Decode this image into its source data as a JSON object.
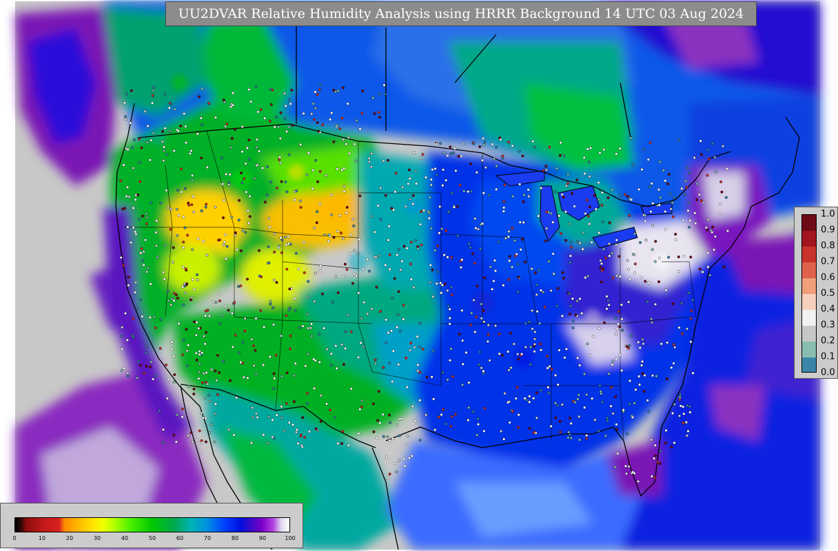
{
  "title": "UU2DVAR Relative Humidity Analysis using HRRR Background 14 UTC 03 Aug 2024",
  "rh_colorbar": {
    "ticks": [
      "0",
      "10",
      "20",
      "30",
      "40",
      "50",
      "60",
      "70",
      "80",
      "90",
      "100"
    ]
  },
  "obs_colorbar": {
    "ticks": [
      "1.0",
      "0.9",
      "0.8",
      "0.7",
      "0.6",
      "0.5",
      "0.4",
      "0.3",
      "0.2",
      "0.1",
      "0.0"
    ],
    "colors": [
      "#6e0a16",
      "#a3151f",
      "#c9332c",
      "#e0624a",
      "#f09f7a",
      "#f7d0bd",
      "#f2f2f2",
      "#c7c7c7",
      "#88bdb0",
      "#3a86a8",
      "#1d4f7c"
    ]
  },
  "colors": {
    "background_gray": "#c8c8c8",
    "ocean_blue": "#1020e0",
    "gulf_light_blue": "#3a6cff",
    "dry_yellow": "#ffd000",
    "moist_purple": "#7a16b4"
  }
}
